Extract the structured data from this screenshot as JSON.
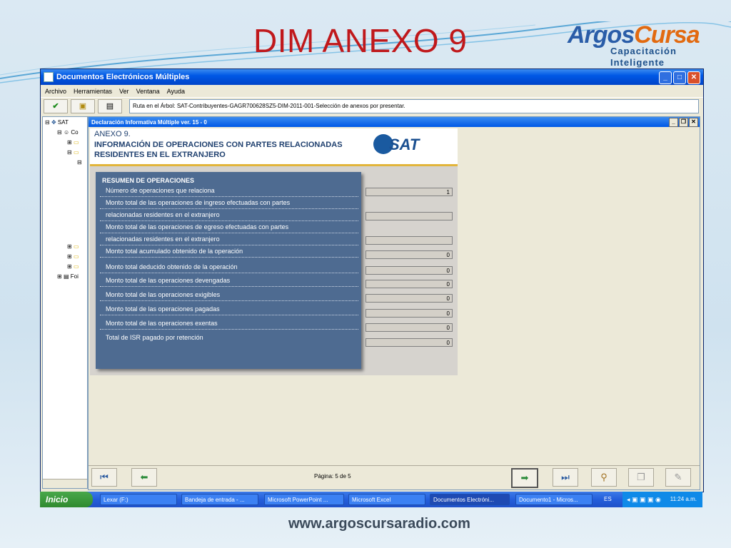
{
  "slide": {
    "title": "DIM ANEXO 9",
    "logo_brand_a": "Argos",
    "logo_brand_b": "Cursa",
    "logo_tag1": "Capacitación",
    "logo_tag2": "Inteligente",
    "footer_url": "www.argoscursaradio.com"
  },
  "window": {
    "title": "Documentos Electrónicos Múltiples",
    "menu": [
      "Archivo",
      "Herramientas",
      "Ver",
      "Ventana",
      "Ayuda"
    ],
    "path": "Ruta en el Árbol: SAT-Contribuyentes-GAGR700628SZ5-DIM-2011-001-Selección de anexos por presentar."
  },
  "tree": {
    "root": "SAT",
    "child1": "Co",
    "child_last": "Foi"
  },
  "inner_window": {
    "title": "Declaración Informativa Múltiple ver. 15 - 0"
  },
  "form": {
    "anexo": "ANEXO 9.",
    "subtitle": "INFORMACIÓN DE OPERACIONES CON PARTES RELACIONADAS RESIDENTES EN EL EXTRANJERO",
    "sat_logo": "SAT",
    "resumen_title": "RESUMEN DE OPERACIONES",
    "rows": [
      {
        "label": "Número de operaciones que relaciona",
        "value": "1"
      },
      {
        "label": "Monto total de las operaciones de ingreso efectuadas con partes",
        "value": null
      },
      {
        "label": "relacionadas residentes en el extranjero",
        "value": ""
      },
      {
        "label": "Monto total de las operaciones de egreso efectuadas con partes",
        "value": null
      },
      {
        "label": "relacionadas residentes en el extranjero",
        "value": ""
      },
      {
        "label": "Monto total acumulado obtenido de la operación",
        "value": "0"
      },
      {
        "label": "Monto total deducido obtenido de la operación",
        "value": "0"
      },
      {
        "label": "Monto total de las operaciones devengadas",
        "value": "0"
      },
      {
        "label": "Monto total de las operaciones exigibles",
        "value": "0"
      },
      {
        "label": "Monto total de las operaciones pagadas",
        "value": "0"
      },
      {
        "label": "Monto total de las operaciones exentas",
        "value": "0"
      },
      {
        "label": "Total de ISR pagado por retención",
        "value": "0"
      }
    ]
  },
  "nav": {
    "pagina_label": "Página: 5  de  5"
  },
  "taskbar": {
    "start": "Inicio",
    "tasks": [
      "Lexar (F:)",
      "Bandeja de entrada - ...",
      "Microsoft PowerPoint ...",
      "Microsoft Excel",
      "Documentos Electróni...",
      "Documento1 - Micros..."
    ],
    "lang": "ES",
    "clock": "11:24 a.m."
  }
}
